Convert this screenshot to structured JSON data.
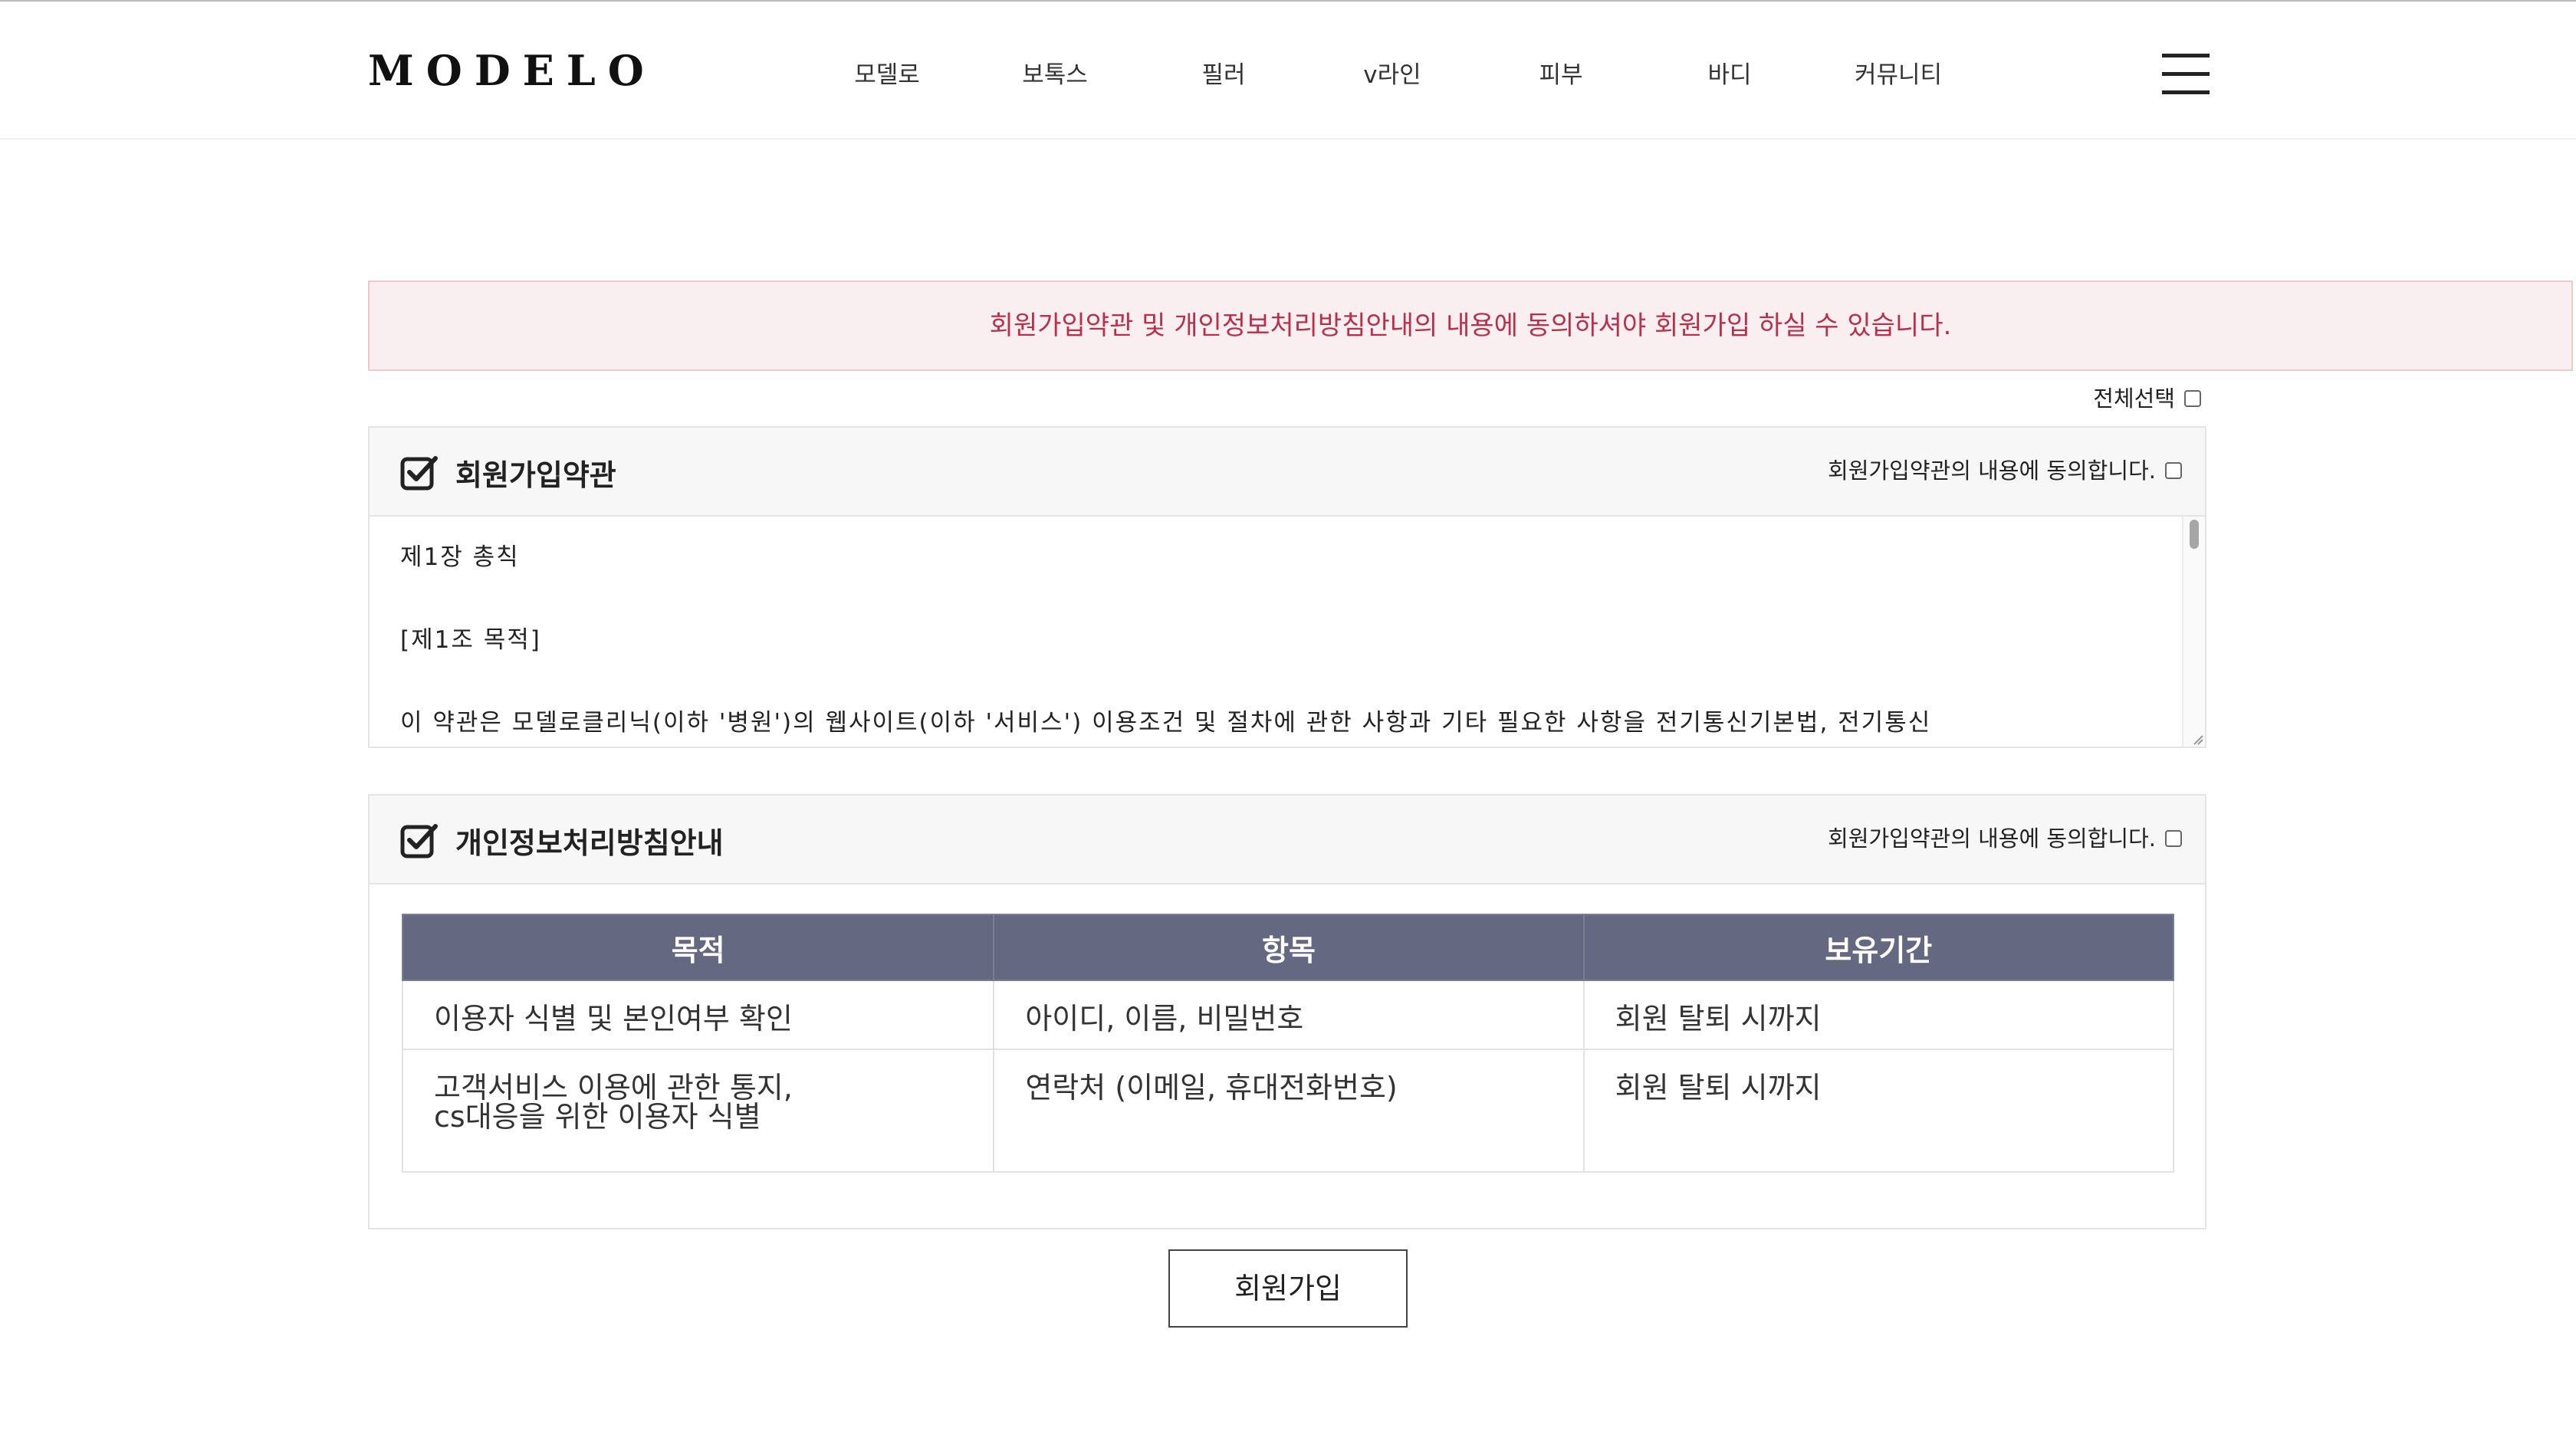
{
  "brand": {
    "logo": "MODELO"
  },
  "nav": {
    "items": [
      "모델로",
      "보톡스",
      "필러",
      "v라인",
      "피부",
      "바디",
      "커뮤니티"
    ]
  },
  "icons": {
    "menu": "hamburger-menu-icon",
    "checked": "checkbox-checked-icon"
  },
  "colors": {
    "accent": "#b8304a",
    "notice_bg": "#f9eef0",
    "table_header": "#646880"
  },
  "notice": "회원가입약관 및 개인정보처리방침안내의 내용에 동의하셔야 회원가입 하실 수 있습니다.",
  "select_all_label": "전체선택",
  "terms_section": {
    "title": "회원가입약관",
    "agree_label": "회원가입약관의 내용에 동의합니다.",
    "content": {
      "chapter": "제1장 총칙",
      "article": "[제1조 목적]",
      "body": "이 약관은 모델로클리닉(이하 '병원')의 웹사이트(이하 '서비스') 이용조건 및 절차에 관한 사항과 기타 필요한 사항을 전기통신기본법, 전기통신"
    }
  },
  "privacy_section": {
    "title": "개인정보처리방침안내",
    "agree_label": "회원가입약관의 내용에 동의합니다.",
    "table": {
      "headers": [
        "목적",
        "항목",
        "보유기간"
      ],
      "rows": [
        [
          "이용자 식별 및 본인여부 확인",
          "아이디, 이름, 비밀번호",
          "회원 탈퇴 시까지"
        ],
        [
          "고객서비스 이용에 관한 통지,\ncs대응을 위한 이용자 식별",
          "연락처 (이메일, 휴대전화번호)",
          "회원 탈퇴 시까지"
        ]
      ]
    }
  },
  "submit_label": "회원가입"
}
